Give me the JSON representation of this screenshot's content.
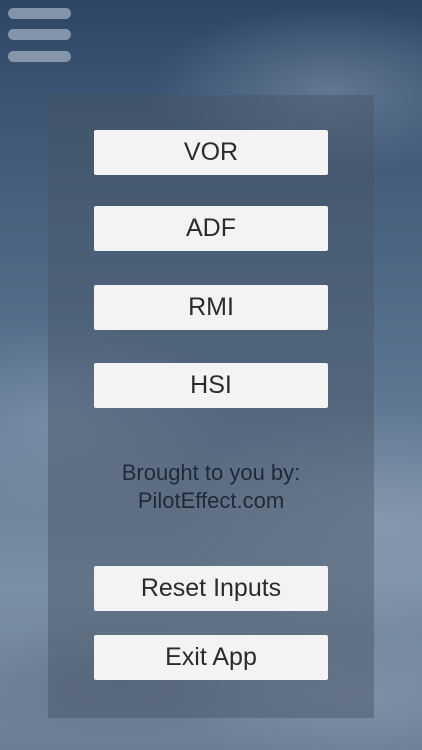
{
  "menu": {
    "icon": "hamburger-menu-icon"
  },
  "buttons": {
    "vor": "VOR",
    "adf": "ADF",
    "rmi": "RMI",
    "hsi": "HSI",
    "reset": "Reset Inputs",
    "exit": "Exit App"
  },
  "credit": {
    "line1": "Brought to you by:",
    "line2": "PilotEffect.com"
  },
  "colors": {
    "button_bg": "#f3f3f3",
    "button_text": "#2b2b2b",
    "panel_overlay": "rgba(70,85,100,0.45)"
  }
}
